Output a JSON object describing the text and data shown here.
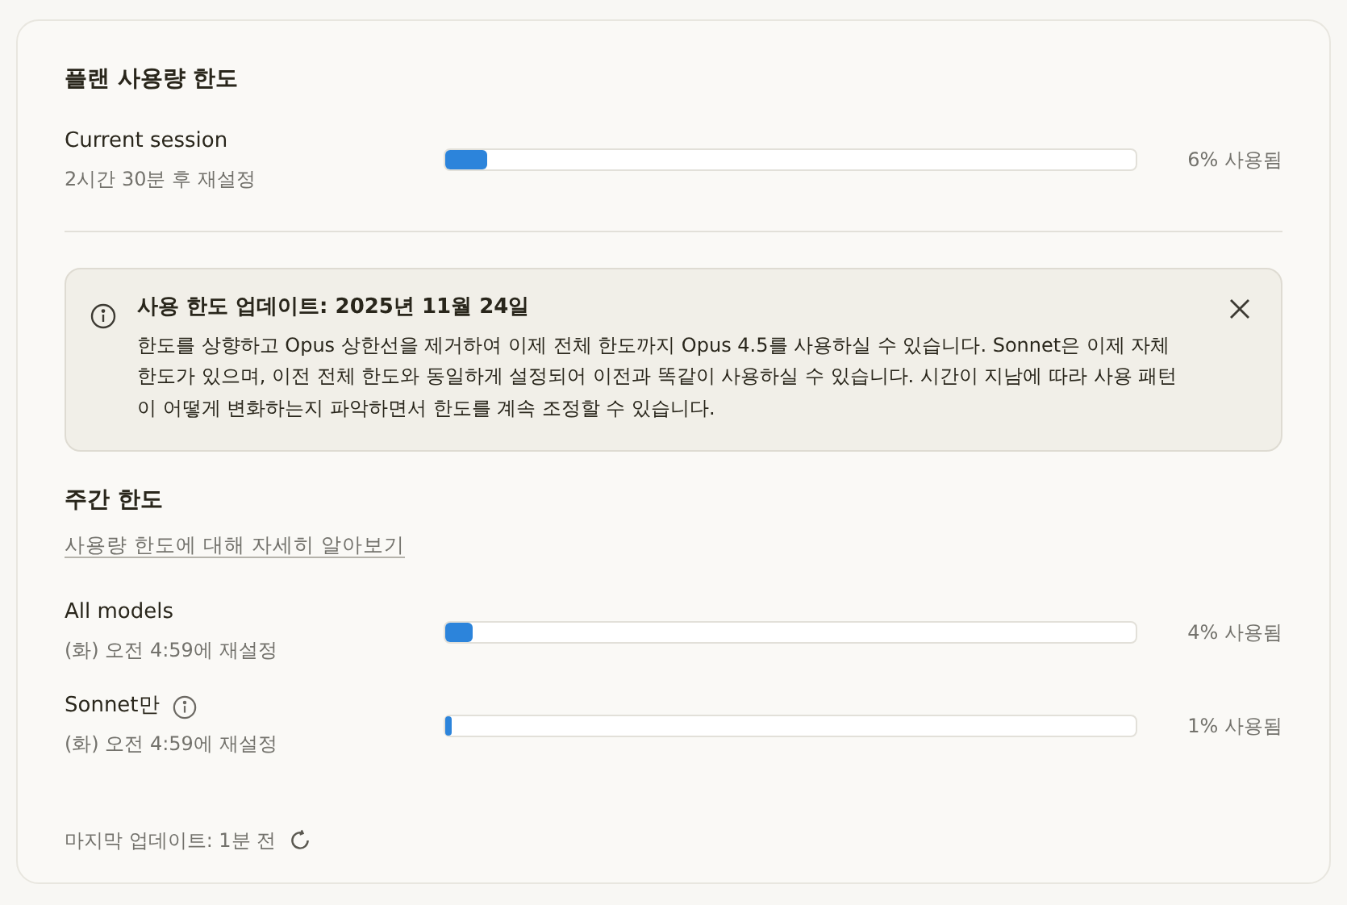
{
  "plan": {
    "title": "플랜 사용량 한도",
    "limits": [
      {
        "name": "Current session",
        "info_icon": false,
        "reset": "2시간 30분 후 재설정",
        "level": 0.06,
        "reading": "6% 사용됨"
      }
    ]
  },
  "notice": {
    "title": "사용 한도 업데이트: 2025년 11월 24일",
    "body": "한도를 상향하고 Opus 상한선을 제거하여 이제 전체 한도까지 Opus 4.5를 사용하실 수 있습니다. Sonnet은 이제 자체 한도가 있으며, 이전 전체 한도와 동일하게 설정되어 이전과 똑같이 사용하실 수 있습니다. 시간이 지남에 따라 사용 패턴이 어떻게 변화하는지 파악하면서 한도를 계속 조정할 수 있습니다."
  },
  "weekly": {
    "title": "주간 한도",
    "link": "사용량 한도에 대해 자세히 알아보기",
    "limits": [
      {
        "name": "All models",
        "info_icon": false,
        "reset": "(화) 오전 4:59에 재설정",
        "level": 0.04,
        "reading": "4% 사용됨"
      },
      {
        "name": "Sonnet만",
        "info_icon": true,
        "reset": "(화) 오전 4:59에 재설정",
        "level": 0.01,
        "reading": "1% 사용됨"
      }
    ]
  },
  "footer": {
    "last_updated": "마지막 업데이트: 1분 전"
  }
}
